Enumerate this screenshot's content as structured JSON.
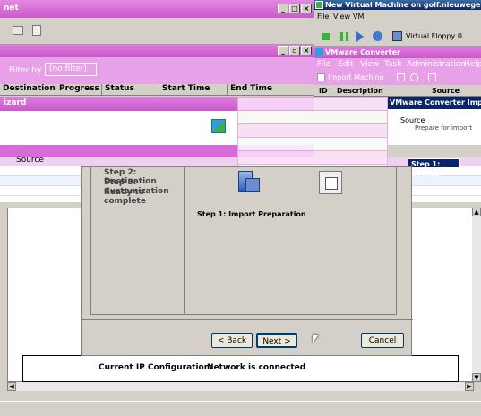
{
  "colors": {
    "accent_pink": "#d66cd6",
    "title_blue": "#0a246a",
    "dialog_bg": "#d4d0c8"
  },
  "bg_window": {
    "title": "net",
    "columns": [
      "Destination",
      "Progress",
      "Status",
      "Start Time",
      "End Time"
    ],
    "filter_left": "Filter by",
    "filter_value": "(no filter)",
    "wizard_title": "izard",
    "source_label": "Source",
    "ip_label": "Current IP Configuration:",
    "ip_value": "Network is connected"
  },
  "vm_window": {
    "title": "New Virtual Machine on golf.nieuwegein.ahrend",
    "menu": [
      "File",
      "View",
      "VM"
    ],
    "floppy_label": "Virtual Floppy 0"
  },
  "converter_window": {
    "title": "VMware Converter",
    "menu": [
      "File",
      "Edit",
      "View",
      "Task",
      "Administration",
      "Help"
    ],
    "import_button": "Import Machine",
    "columns": [
      "ID",
      "Description",
      "Source"
    ],
    "import_title": "VMware Converter Import W",
    "source_heading": "Source",
    "source_sub": "Prepare for import",
    "step_badge": "Step 1: Source"
  },
  "wizard": {
    "steps": [
      "Step 2: Destination",
      "Step 3: Customization",
      "Ready to complete"
    ],
    "step_title": "Step 1: Import Preparation",
    "back_button": "< Back",
    "next_button": "Next >",
    "cancel_button": "Cancel"
  },
  "icons": [
    "computer-icon",
    "vm-icon",
    "floppy-icon",
    "play-icon",
    "pause-icon",
    "mouse-cursor-icon"
  ]
}
